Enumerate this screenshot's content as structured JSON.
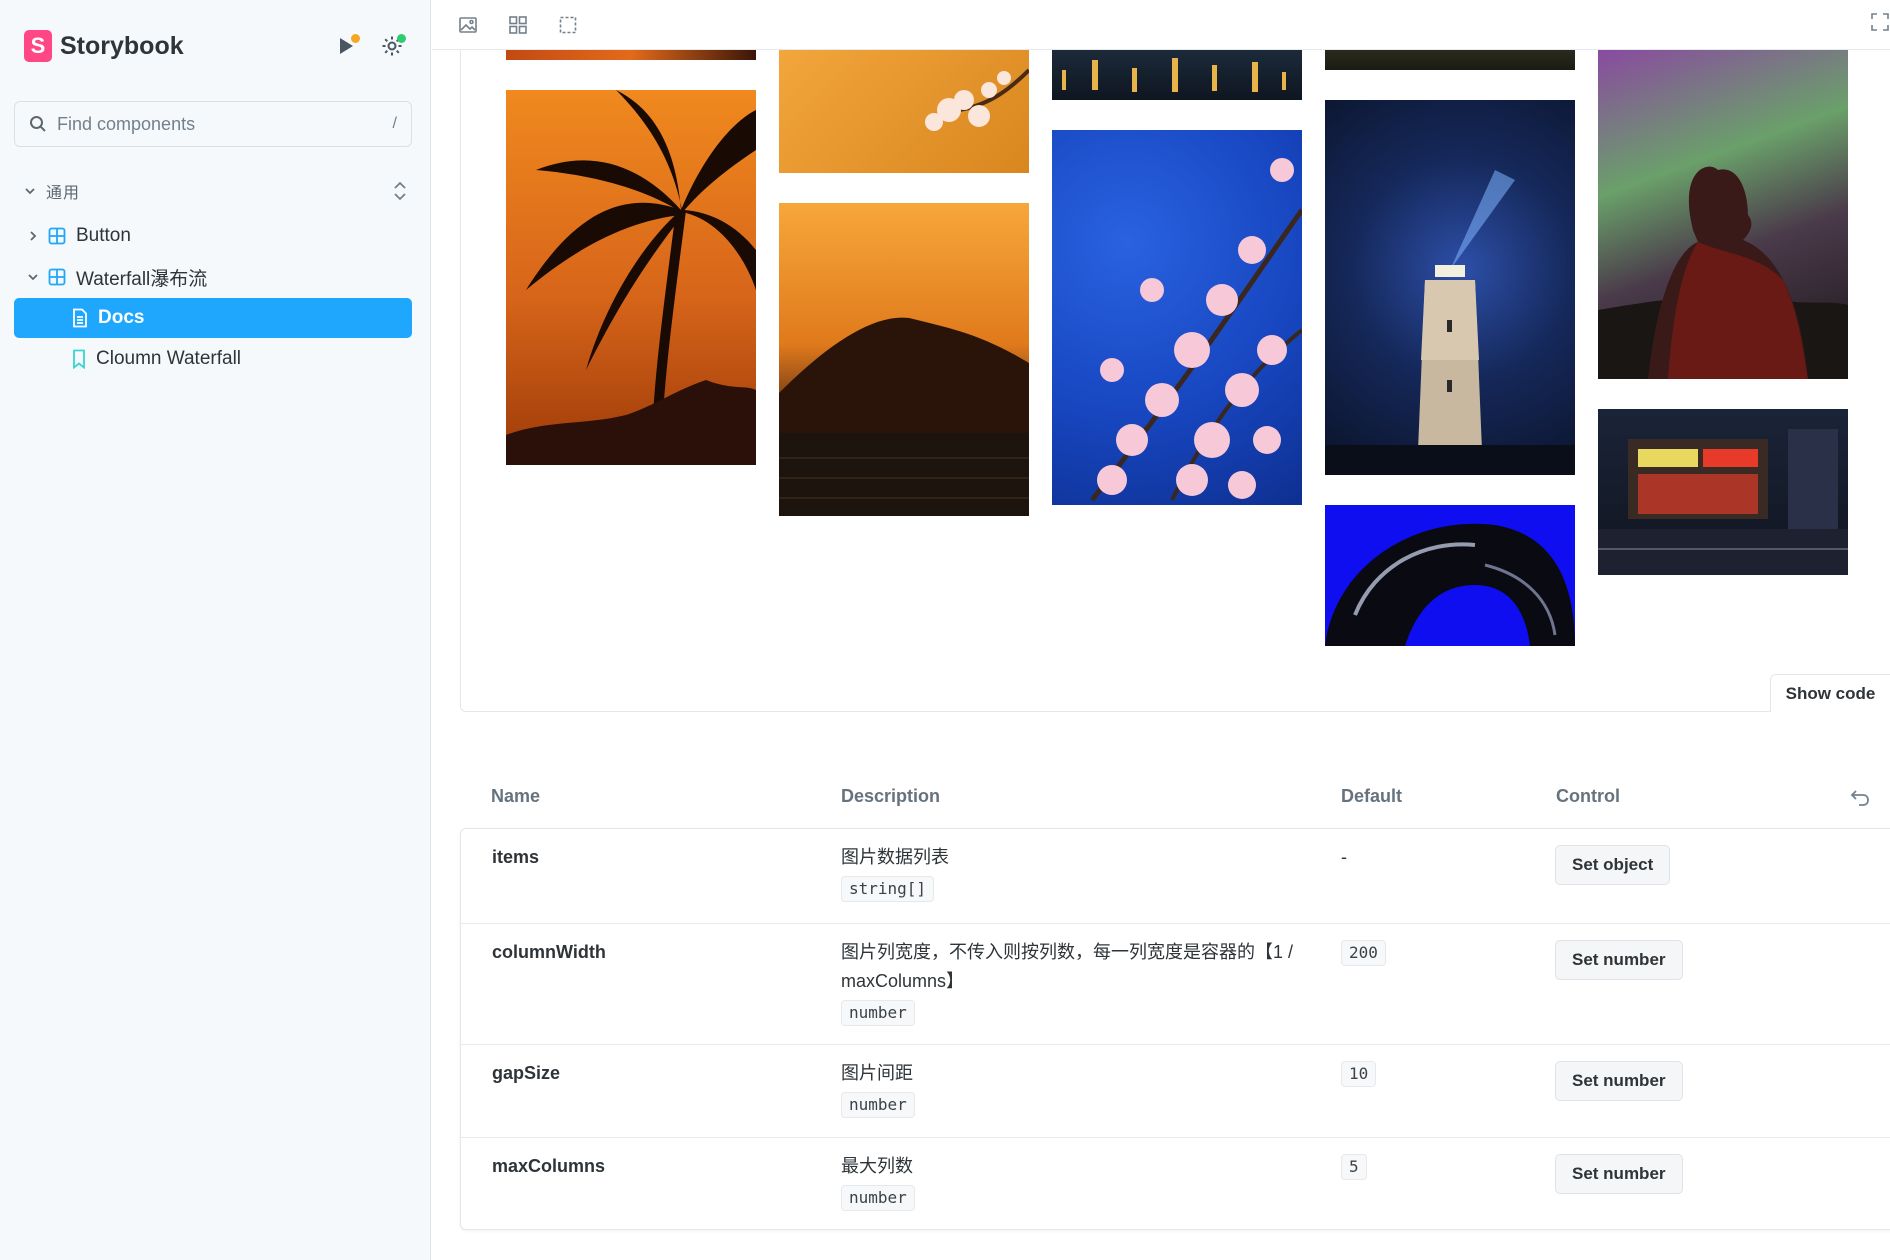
{
  "sidebar": {
    "brand": "Storybook",
    "search": {
      "placeholder": "Find components",
      "shortcut": "/"
    },
    "group": "通用",
    "items": [
      {
        "label": "Button",
        "kind": "component",
        "expanded": false
      },
      {
        "label": "Waterfall瀑布流",
        "kind": "component",
        "expanded": true
      },
      {
        "label": "Docs",
        "kind": "docs",
        "selected": true
      },
      {
        "label": "Cloumn Waterfall",
        "kind": "story"
      }
    ]
  },
  "toolbar": {
    "icons": [
      "image-icon",
      "grid-icon",
      "outline-icon",
      "fullscreen-icon"
    ]
  },
  "canvas": {
    "show_code": "Show code",
    "tiles": [
      {
        "subject": "orange-strip",
        "colors": [
          "#c24a12",
          "#e36a1a"
        ]
      },
      {
        "subject": "palm-silhouette",
        "colors": [
          "#f0891e",
          "#9c3a08"
        ]
      },
      {
        "subject": "cherry-on-orange",
        "colors": [
          "#f2a63c",
          "#d9861f"
        ]
      },
      {
        "subject": "orange-sunset-mountain",
        "colors": [
          "#f6a73a",
          "#2a1a10"
        ]
      },
      {
        "subject": "city-night",
        "colors": [
          "#1c2a3a",
          "#e8b44a"
        ]
      },
      {
        "subject": "cherry-blossom-blue",
        "colors": [
          "#1746c0",
          "#f6c8d8"
        ]
      },
      {
        "subject": "dark-strip",
        "colors": [
          "#2a2a1e",
          "#1b1b12"
        ]
      },
      {
        "subject": "lighthouse-night",
        "colors": [
          "#0f1c3e",
          "#2d4fa8"
        ]
      },
      {
        "subject": "abstract-blue",
        "colors": [
          "#0e0ef0",
          "#0a0a12"
        ]
      },
      {
        "subject": "aurora-portrait",
        "colors": [
          "#8a4aa0",
          "#3a1a18"
        ]
      },
      {
        "subject": "street-night",
        "colors": [
          "#1a2438",
          "#c83a28"
        ]
      }
    ]
  },
  "args": {
    "headers": {
      "name": "Name",
      "description": "Description",
      "default": "Default",
      "control": "Control"
    },
    "rows": [
      {
        "name": "items",
        "description": "图片数据列表",
        "type": "string[]",
        "default": "-",
        "control": "Set object"
      },
      {
        "name": "columnWidth",
        "description": "图片列宽度，不传入则按列数，每一列宽度是容器的【1 / maxColumns】",
        "type": "number",
        "default": "200",
        "control": "Set number"
      },
      {
        "name": "gapSize",
        "description": "图片间距",
        "type": "number",
        "default": "10",
        "control": "Set number"
      },
      {
        "name": "maxColumns",
        "description": "最大列数",
        "type": "number",
        "default": "5",
        "control": "Set number"
      }
    ]
  },
  "colors": {
    "accent": "#1ea7fd",
    "brand": "#ff4785",
    "sidebar_bg": "#f6f9fc"
  }
}
